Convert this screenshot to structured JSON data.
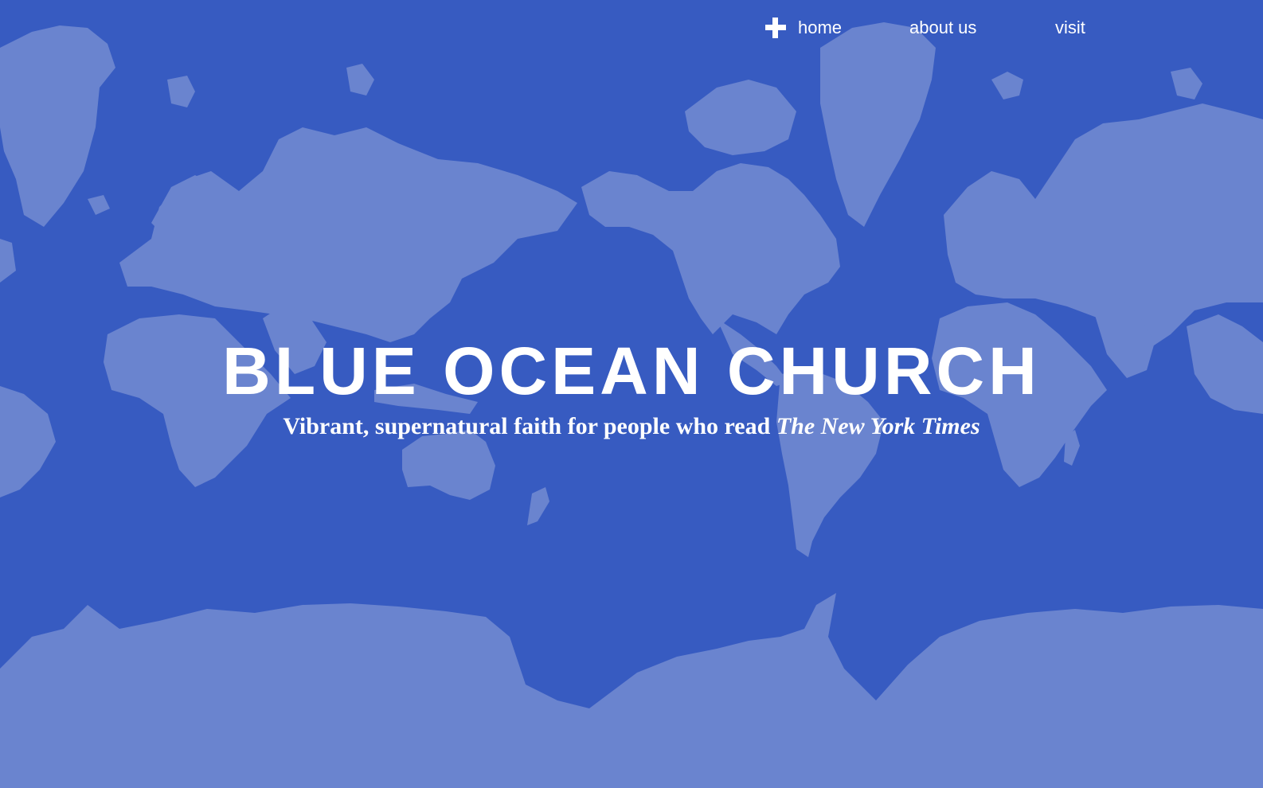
{
  "nav": {
    "items": [
      {
        "label": "home",
        "icon": "plus-icon"
      },
      {
        "label": "about us"
      },
      {
        "label": "visit"
      }
    ]
  },
  "hero": {
    "title": "BLUE OCEAN CHURCH",
    "tagline_prefix": "Vibrant, supernatural faith for people who read ",
    "tagline_emphasis": "The New York Times"
  },
  "colors": {
    "ocean": "#375bc1",
    "land": "#6a84cf",
    "text": "#ffffff"
  },
  "background": {
    "image": "world-map"
  }
}
